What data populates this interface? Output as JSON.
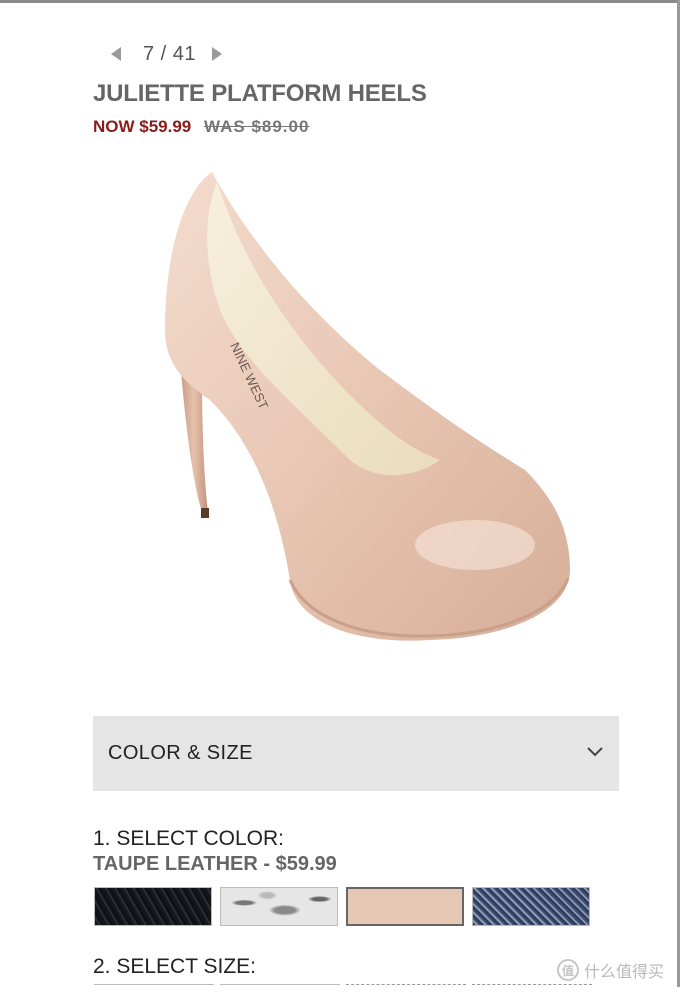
{
  "pager": {
    "counter": "7 / 41"
  },
  "product": {
    "title": "JULIETTE PLATFORM HEELS",
    "price_now": "NOW $59.99",
    "price_was": "WAS $89.00",
    "shoe_logo_text": "NINE WEST"
  },
  "accordion": {
    "label": "COLOR & SIZE",
    "icon": "chevron-down-icon"
  },
  "color_select": {
    "heading": "1. SELECT COLOR:",
    "selected_label": "TAUPE LEATHER - $59.99",
    "swatches": [
      {
        "name": "black",
        "color": "#1b1d23"
      },
      {
        "name": "snake",
        "color": "#d9d9d9"
      },
      {
        "name": "taupe",
        "color": "#e6c7b4",
        "selected": true
      },
      {
        "name": "denim",
        "color": "#4a5778"
      }
    ]
  },
  "size_select": {
    "heading": "2. SELECT SIZE:"
  },
  "watermark": {
    "icon_glyph": "值",
    "text": "什么值得买"
  },
  "colors": {
    "sale_red": "#8b1c1c",
    "heading_gray": "#666666",
    "panel_bg": "#e5e5e5"
  }
}
